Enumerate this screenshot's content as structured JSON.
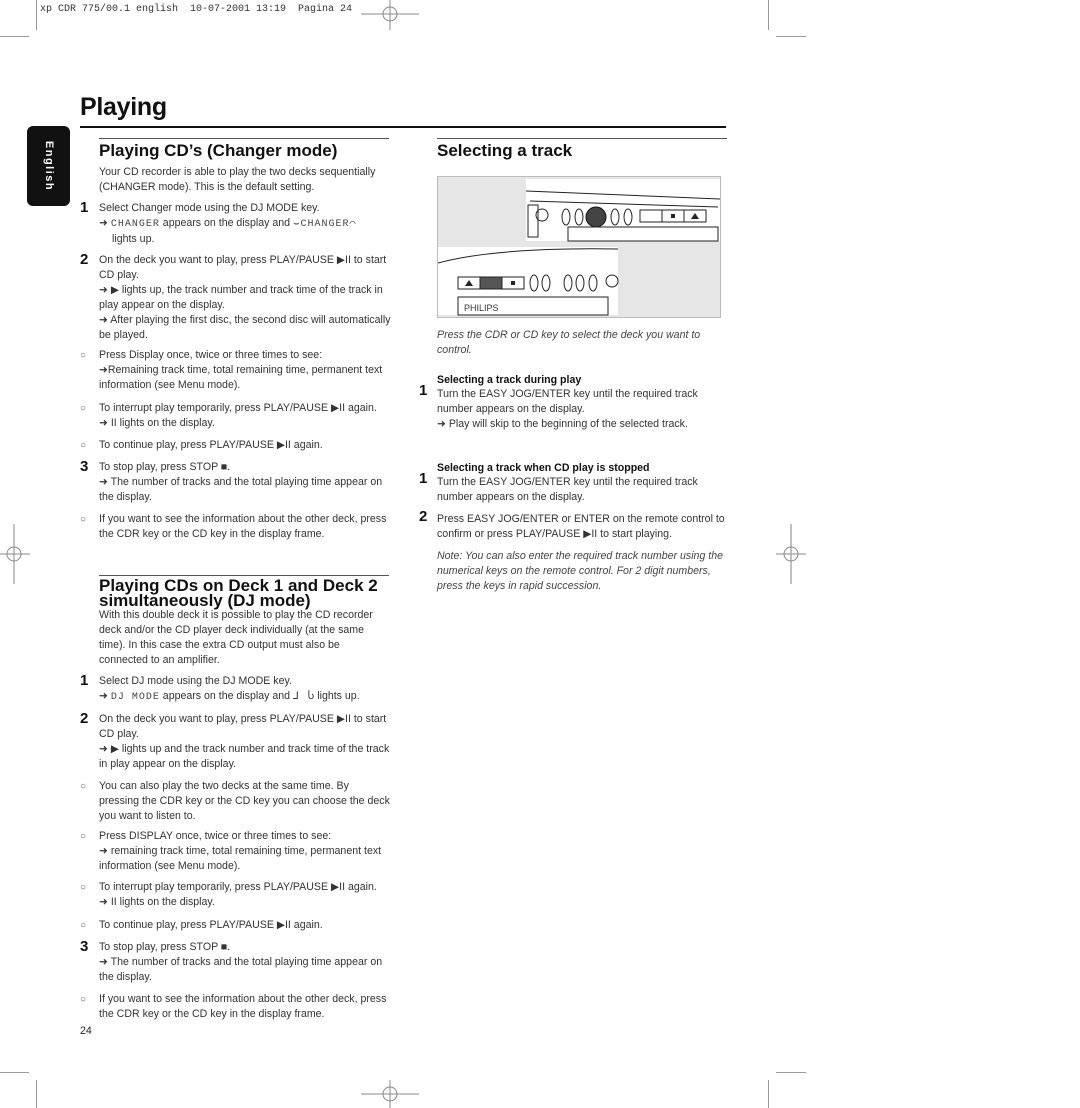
{
  "slug": "xp CDR 775/00.1 english  10-07-2001 13:19  Pagina 24",
  "page_title": "Playing",
  "language_tab": "English",
  "page_number": "24",
  "left": {
    "section1": {
      "heading": "Playing CD’s (Changer mode)",
      "intro": "Your CD recorder is able to play the two decks sequentially (CHANGER mode). This is the default setting.",
      "step1": {
        "num": "1",
        "text": "Select Changer mode using the DJ MODE key.",
        "arrow_lcd": "CHANGER",
        "arrow_mid": "appears on the display and",
        "arrow_lcd2": "⌣CHANGER⌒",
        "arrow_end": "lights up."
      },
      "step2": {
        "num": "2",
        "text": "On the deck you want to play, press PLAY/PAUSE ▶II to start CD play.",
        "arrow1": "➜ ▶ lights up, the track number and track time of the track in play appear on the display.",
        "arrow2": "➜ After playing the first disc, the second disc will automatically be played."
      },
      "bullet1": {
        "text": "Press Display once, twice or three times to see:",
        "arrow": "➜Remaining track time, total remaining time, permanent text information (see Menu mode)."
      },
      "bullet2": {
        "text": "To interrupt play temporarily, press PLAY/PAUSE ▶II again.",
        "arrow": "➜ II lights on the display."
      },
      "bullet3": {
        "text": "To continue play, press PLAY/PAUSE ▶II again."
      },
      "step3": {
        "num": "3",
        "text": "To stop play, press STOP ■.",
        "arrow": "➜ The number of tracks and the total playing time appear on the display."
      },
      "bullet4": {
        "text": "If you want to see the information about the other deck, press the CDR key or the CD key in the display frame."
      }
    },
    "section2": {
      "heading": "Playing CDs on Deck 1 and Deck 2 simultaneously (DJ mode)",
      "intro": "With this double deck it is possible to play the CD recorder deck and/or the CD player deck individually (at the same time). In this case the extra CD output must also be connected to an amplifier.",
      "step1": {
        "num": "1",
        "text": "Select DJ mode using the DJ MODE key.",
        "arrow_lcd": "DJ MODE",
        "arrow_mid": "appears on the display and",
        "arrow_sym": "⅃   Ⴑ",
        "arrow_end": "lights up."
      },
      "step2": {
        "num": "2",
        "text": "On the deck you want to play, press PLAY/PAUSE ▶II to start CD play.",
        "arrow": "➜ ▶ lights up and the track number and track time of the track in play appear on the display."
      },
      "bullet1": {
        "text": "You can also play the two decks at the same time. By pressing the CDR key or the CD key you can choose the deck you want to listen to."
      },
      "bullet2": {
        "text": "Press DISPLAY once, twice or three times to see:",
        "arrow": "➜ remaining track time, total remaining time, permanent text information (see Menu mode)."
      },
      "bullet3": {
        "text": "To interrupt play temporarily, press PLAY/PAUSE ▶II again.",
        "arrow": "➜ II lights on the display."
      },
      "bullet4": {
        "text": "To continue play, press PLAY/PAUSE ▶II again."
      },
      "step3": {
        "num": "3",
        "text": "To stop play, press STOP ■.",
        "arrow": "➜ The number of tracks and the total playing time appear on the display."
      },
      "bullet5": {
        "text": "If you want to see the information about the other deck, press the CDR key or the CD key in the display frame."
      }
    }
  },
  "right": {
    "heading": "Selecting a track",
    "illustration": {
      "brand": "PHILIPS",
      "highlight_color": "#555555"
    },
    "caption": "Press the CDR or CD key to select the deck you want to control.",
    "sub1": {
      "title": "Selecting a track during play",
      "num": "1",
      "text": "Turn the EASY JOG/ENTER key until the required track number appears on the display.",
      "arrow": "➜ Play will skip to the beginning of the selected track."
    },
    "sub2": {
      "title": "Selecting a track when CD play is stopped",
      "step1": {
        "num": "1",
        "text": "Turn the EASY JOG/ENTER key until the required track number appears on  the display."
      },
      "step2": {
        "num": "2",
        "text": "Press EASY JOG/ENTER or ENTER on the remote control to confirm or press PLAY/PAUSE ▶II  to start playing."
      }
    },
    "note": "Note: You can also enter the required track number using the numerical keys on the remote control. For 2 digit numbers, press the keys in rapid succession."
  },
  "bullet_glyph": "○"
}
